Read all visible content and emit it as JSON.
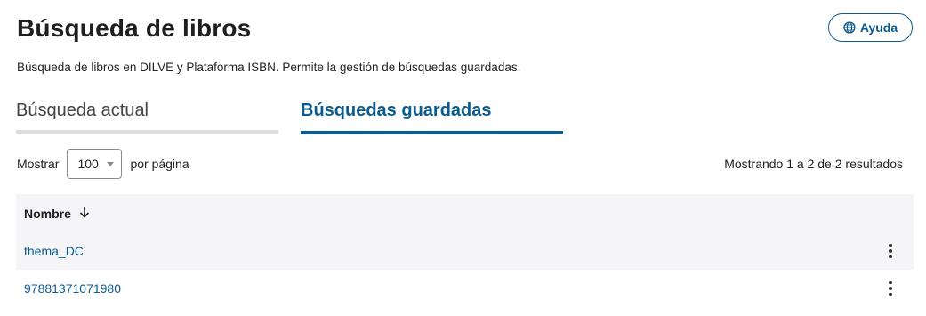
{
  "header": {
    "title": "Búsqueda de libros",
    "subtitle": "Búsqueda de libros en DILVE y Plataforma ISBN. Permite la gestión de búsquedas guardadas.",
    "help_label": "Ayuda",
    "help_icon": "globe-icon"
  },
  "tabs": [
    {
      "label": "Búsqueda actual",
      "active": false
    },
    {
      "label": "Búsquedas guardadas",
      "active": true
    }
  ],
  "pagination": {
    "show_label": "Mostrar",
    "per_page_value": "100",
    "per_page_suffix": "por página",
    "results_text": "Mostrando 1 a 2 de 2 resultados"
  },
  "table": {
    "column_name": "Nombre",
    "sort_icon": "arrow-down-icon",
    "rows": [
      {
        "name": "thema_DC"
      },
      {
        "name": "97881371071980"
      }
    ]
  },
  "colors": {
    "accent": "#0b5c8f",
    "row_stripe": "#f5f5f7",
    "inactive_tab_line": "#dcdcdc"
  }
}
